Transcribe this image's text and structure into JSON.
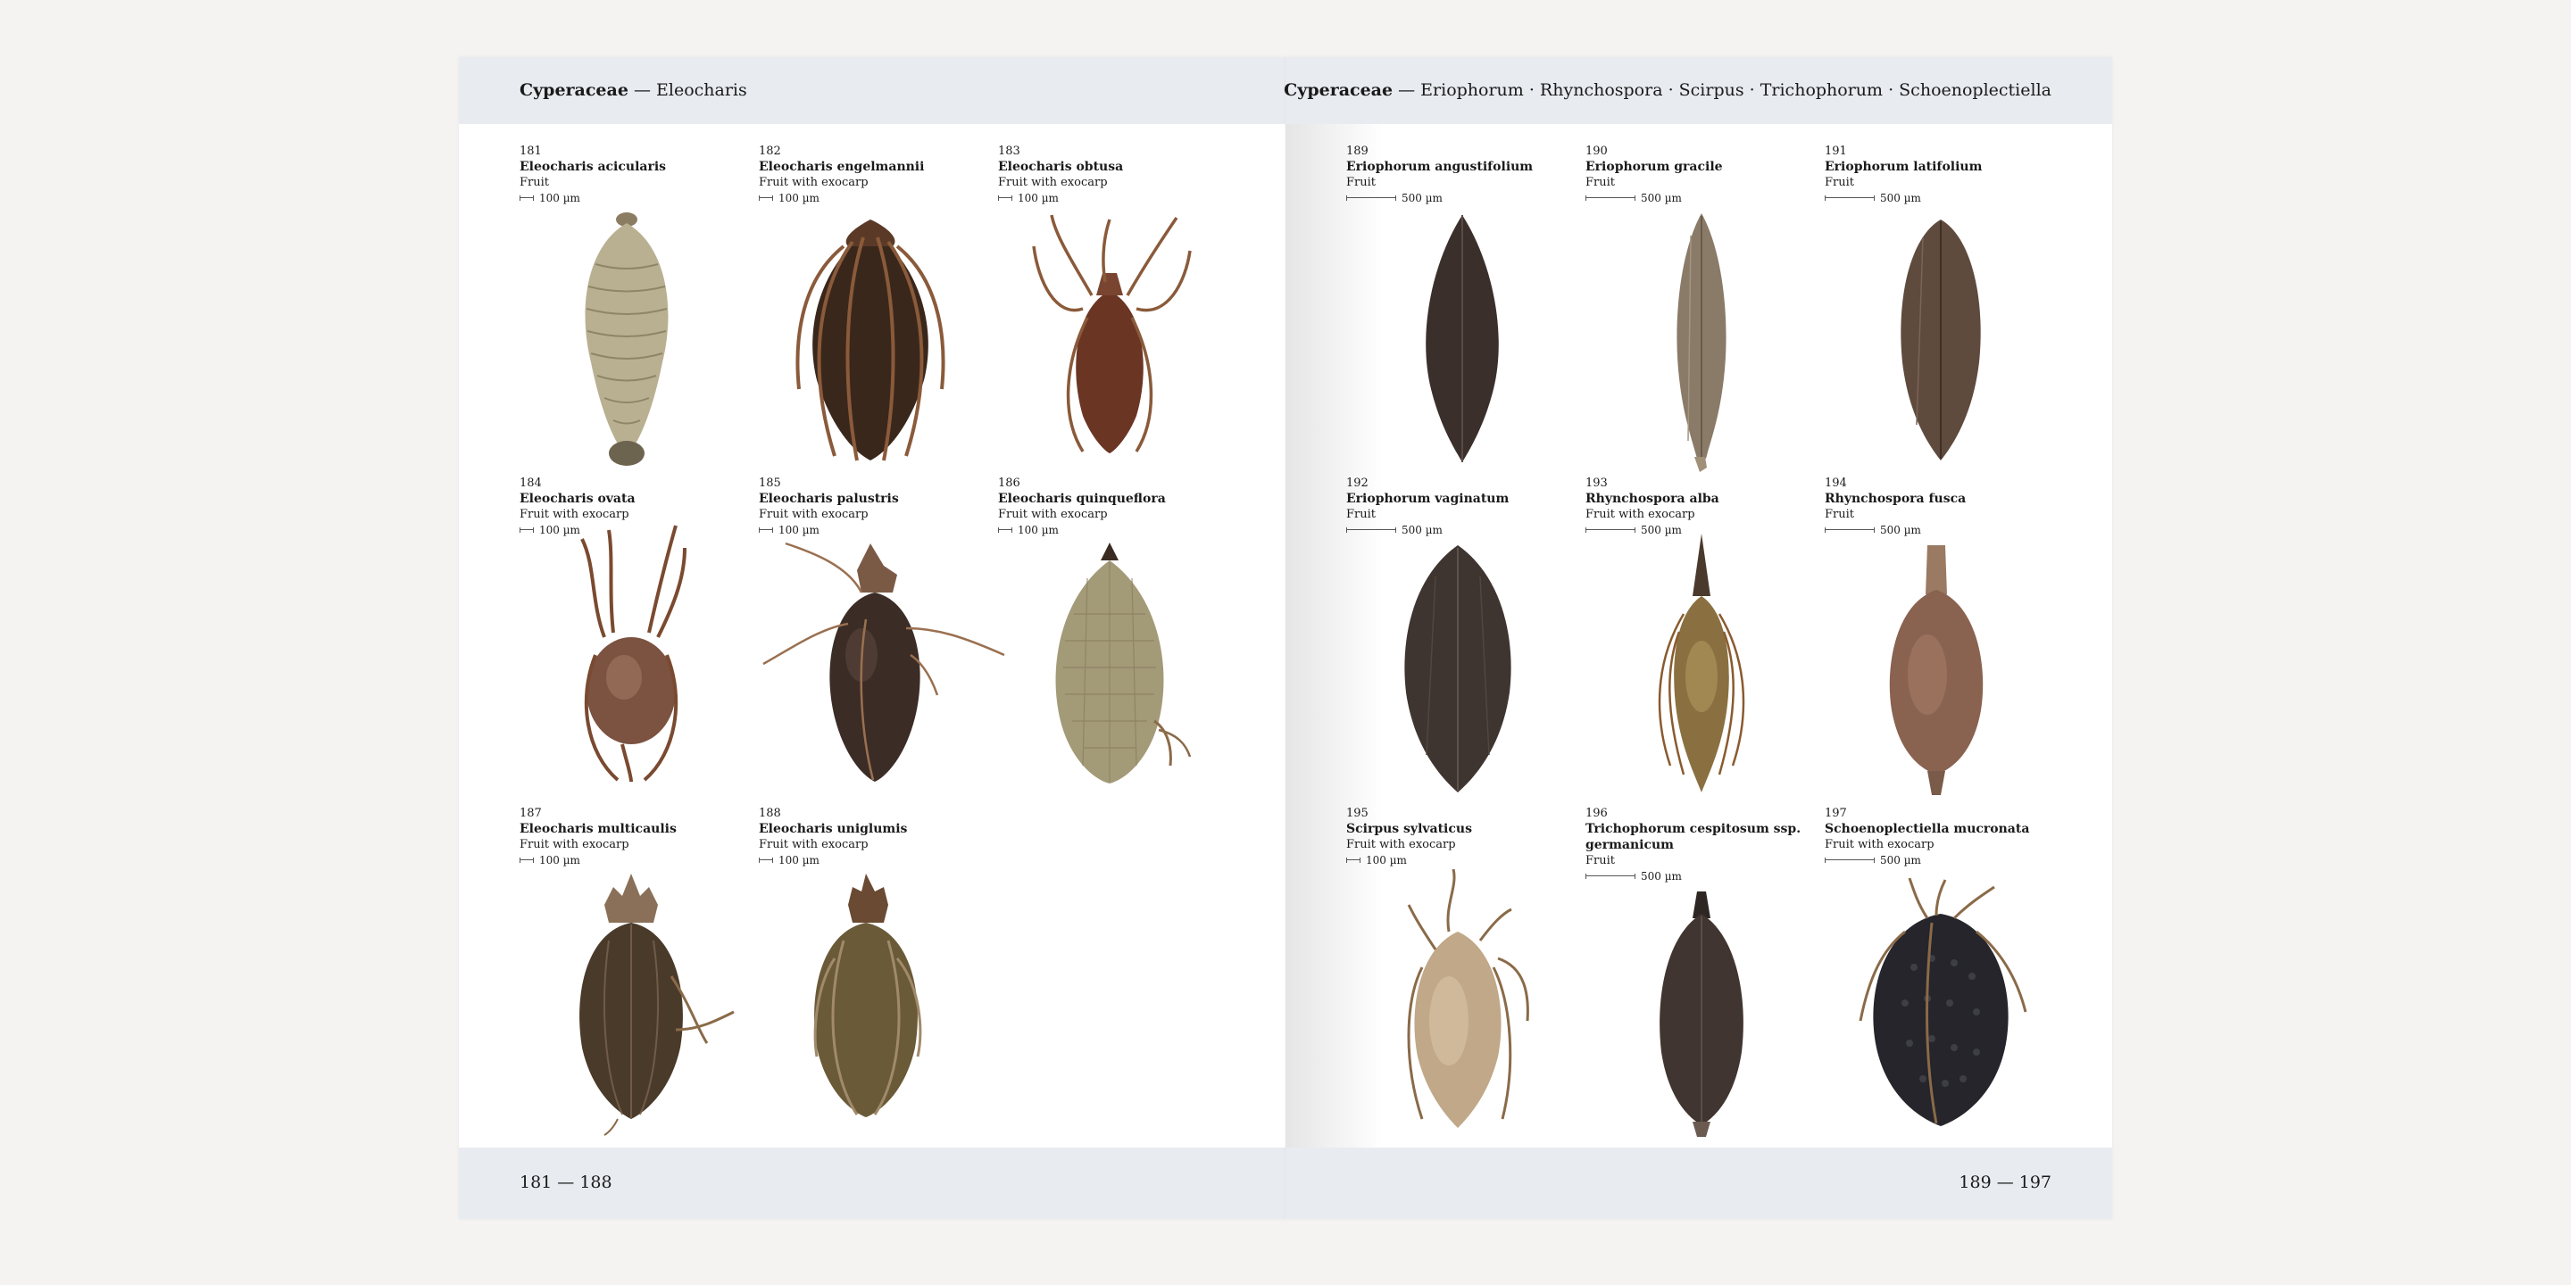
{
  "left_page": {
    "header": {
      "family": "Cyperaceae",
      "separator": "—",
      "genera": "Eleocharis"
    },
    "page_range": "181 — 188",
    "specimens": [
      {
        "number": "181",
        "name": "Eleocharis acicularis",
        "type": "Fruit",
        "scale": "100 µm"
      },
      {
        "number": "182",
        "name": "Eleocharis engelmannii",
        "type": "Fruit with exocarp",
        "scale": "100 µm"
      },
      {
        "number": "183",
        "name": "Eleocharis obtusa",
        "type": "Fruit with exocarp",
        "scale": "100 µm"
      },
      {
        "number": "184",
        "name": "Eleocharis ovata",
        "type": "Fruit with exocarp",
        "scale": "100 µm"
      },
      {
        "number": "185",
        "name": "Eleocharis palustris",
        "type": "Fruit with exocarp",
        "scale": "100 µm"
      },
      {
        "number": "186",
        "name": "Eleocharis quinqueflora",
        "type": "Fruit with exocarp",
        "scale": "100 µm"
      },
      {
        "number": "187",
        "name": "Eleocharis multicaulis",
        "type": "Fruit with exocarp",
        "scale": "100 µm"
      },
      {
        "number": "188",
        "name": "Eleocharis uniglumis",
        "type": "Fruit with exocarp",
        "scale": "100 µm"
      }
    ]
  },
  "right_page": {
    "header": {
      "family": "Cyperaceae",
      "separator": "—",
      "genera": "Eriophorum · Rhynchospora · Scirpus · Trichophorum · Schoenoplectiella"
    },
    "page_range": "189 — 197",
    "specimens": [
      {
        "number": "189",
        "name": "Eriophorum angustifolium",
        "type": "Fruit",
        "scale": "500 µm"
      },
      {
        "number": "190",
        "name": "Eriophorum gracile",
        "type": "Fruit",
        "scale": "500 µm"
      },
      {
        "number": "191",
        "name": "Eriophorum latifolium",
        "type": "Fruit",
        "scale": "500 µm"
      },
      {
        "number": "192",
        "name": "Eriophorum vaginatum",
        "type": "Fruit",
        "scale": "500 µm"
      },
      {
        "number": "193",
        "name": "Rhynchospora alba",
        "type": "Fruit with exocarp",
        "scale": "500 µm"
      },
      {
        "number": "194",
        "name": "Rhynchospora fusca",
        "type": "Fruit",
        "scale": "500 µm"
      },
      {
        "number": "195",
        "name": "Scirpus sylvaticus",
        "type": "Fruit with exocarp",
        "scale": "100 µm"
      },
      {
        "number": "196",
        "name": "Trichophorum cespitosum ssp. germanicum",
        "type": "Fruit",
        "scale": "500 µm"
      },
      {
        "number": "197",
        "name": "Schoenoplectiella mucronata",
        "type": "Fruit with exocarp",
        "scale": "500 µm"
      }
    ]
  }
}
